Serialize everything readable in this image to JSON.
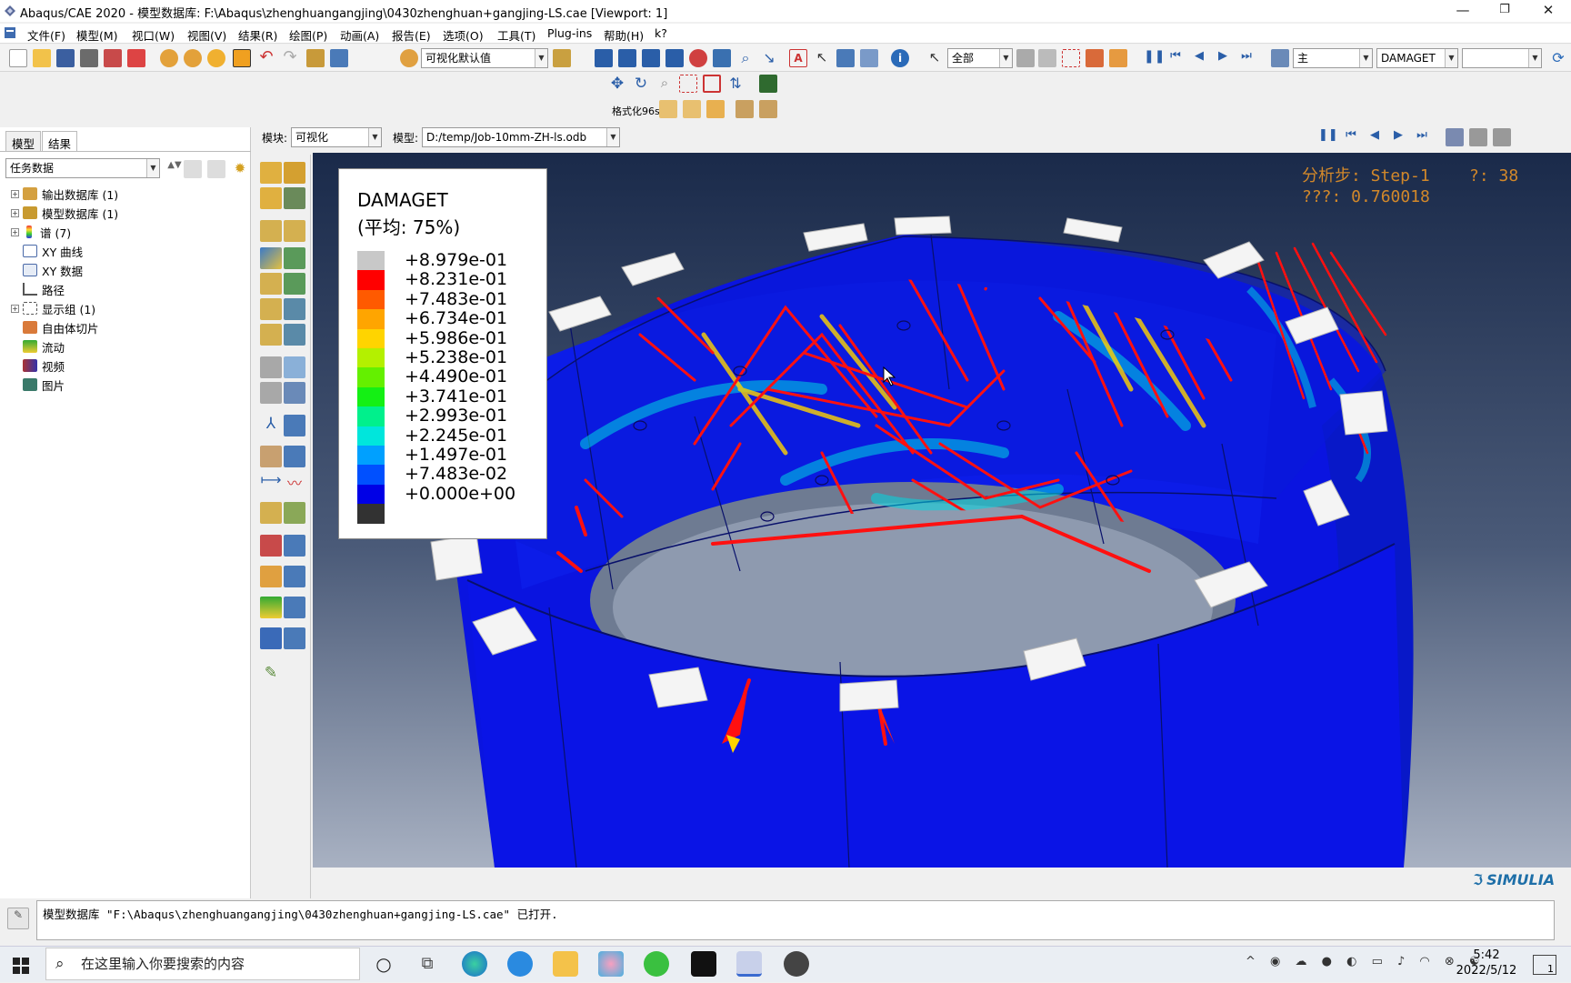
{
  "window": {
    "title": "Abaqus/CAE 2020 - 模型数据库: F:\\Abaqus\\zhenghuangangjing\\0430zhenghuan+gangjing-LS.cae [Viewport: 1]",
    "min": "—",
    "restore": "❐",
    "close": "✕"
  },
  "menu": [
    "文件(F)",
    "模型(M)",
    "视口(W)",
    "视图(V)",
    "结果(R)",
    "绘图(P)",
    "动画(A)",
    "报告(E)",
    "选项(O)",
    "工具(T)",
    "Plug-ins",
    "帮助(H)",
    "k?"
  ],
  "toolbar": {
    "render_style": "可视化默认值",
    "selection_scope": "全部",
    "field_output_step": "主",
    "field_variable": "DAMAGET",
    "component": ""
  },
  "subtoolbar": {
    "format_label": "格式化96s"
  },
  "module_bar": {
    "module_label": "模块:",
    "module_value": "可视化",
    "model_label": "模型:",
    "model_value": "D:/temp/Job-10mm-ZH-ls.odb"
  },
  "left_panel": {
    "tabs": [
      "模型",
      "结果"
    ],
    "active_tab": "结果",
    "filter": "任务数据",
    "tree": [
      {
        "label": "输出数据库 (1)",
        "expandable": true,
        "icon": "database-icon"
      },
      {
        "label": "模型数据库 (1)",
        "expandable": true,
        "icon": "database-icon"
      },
      {
        "label": "谱 (7)",
        "expandable": true,
        "icon": "spectrum-icon"
      },
      {
        "label": "XY 曲线",
        "expandable": false,
        "icon": "xy-plot-icon"
      },
      {
        "label": "XY 数据",
        "expandable": false,
        "icon": "xy-data-icon"
      },
      {
        "label": "路径",
        "expandable": false,
        "icon": "path-icon"
      },
      {
        "label": "显示组 (1)",
        "expandable": true,
        "icon": "display-group-icon"
      },
      {
        "label": "自由体切片",
        "expandable": false,
        "icon": "free-body-icon"
      },
      {
        "label": "流动",
        "expandable": false,
        "icon": "stream-icon"
      },
      {
        "label": "视频",
        "expandable": false,
        "icon": "movie-icon"
      },
      {
        "label": "图片",
        "expandable": false,
        "icon": "image-icon"
      }
    ]
  },
  "legend": {
    "variable": "DAMAGET",
    "averaging": "(平均: 75%)",
    "values": [
      "+8.979e-01",
      "+8.231e-01",
      "+7.483e-01",
      "+6.734e-01",
      "+5.986e-01",
      "+5.238e-01",
      "+4.490e-01",
      "+3.741e-01",
      "+2.993e-01",
      "+2.245e-01",
      "+1.497e-01",
      "+7.483e-02",
      "+0.000e+00"
    ],
    "colors": [
      "#c8c8c8",
      "#ff0000",
      "#ff5a00",
      "#ffa500",
      "#ffd400",
      "#b4f000",
      "#64f000",
      "#14f014",
      "#00f08c",
      "#00e6dc",
      "#00a0ff",
      "#0050ff",
      "#0000e6",
      "#323232"
    ]
  },
  "step_info": {
    "line1": "分析步: Step-1    ?: 38",
    "line2": "???: 0.760018"
  },
  "brand": "SIMULIA",
  "message": "模型数据库 \"F:\\Abaqus\\zhenghuangangjing\\0430zhenghuan+gangjing-LS.cae\" 已打开.",
  "taskbar": {
    "search_placeholder": "在这里输入你要搜索的内容",
    "time": "5:42",
    "date": "2022/5/12",
    "notification_count": "1"
  }
}
